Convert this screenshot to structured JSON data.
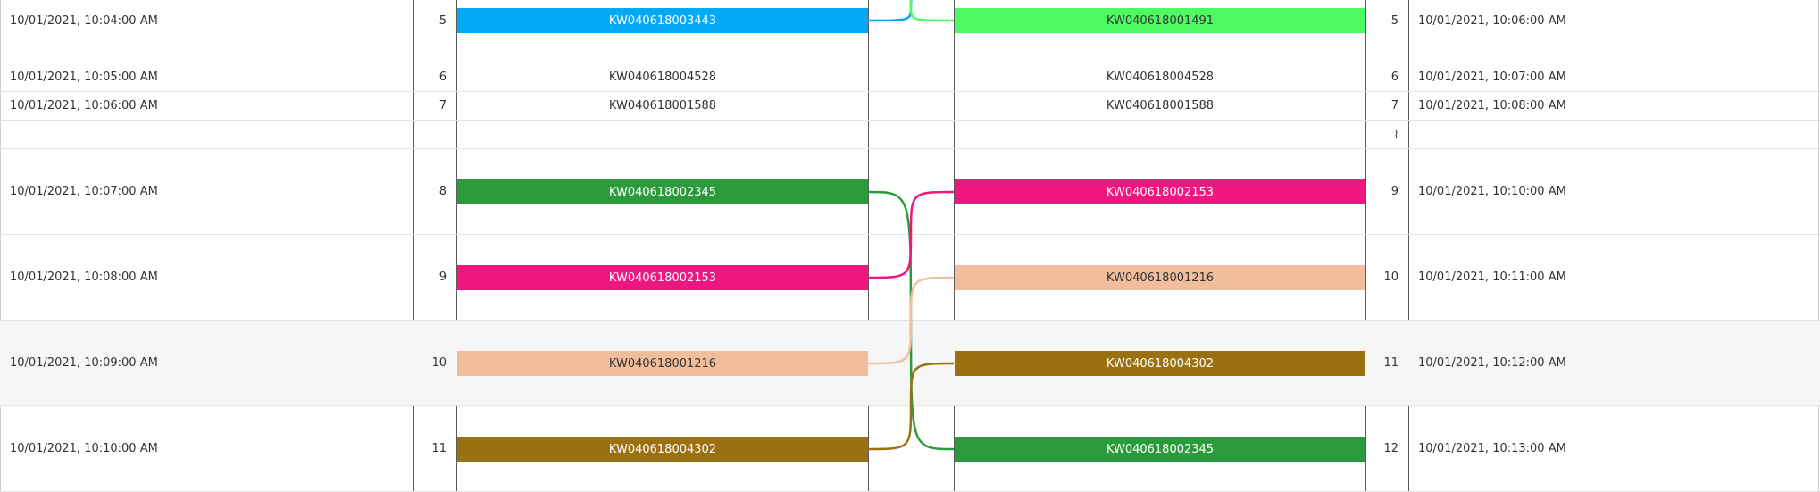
{
  "left_rows": [
    {
      "time": "10/01/2021, 10:04:00 AM",
      "index": "5",
      "value": "KW040618003443"
    },
    {
      "time": "10/01/2021, 10:05:00 AM",
      "index": "6",
      "value": "KW040618004528"
    },
    {
      "time": "10/01/2021, 10:06:00 AM",
      "index": "7",
      "value": "KW040618001588"
    },
    {
      "time": "",
      "index": "",
      "value": ""
    },
    {
      "time": "10/01/2021, 10:07:00 AM",
      "index": "8",
      "value": "KW040618002345"
    },
    {
      "time": "10/01/2021, 10:08:00 AM",
      "index": "9",
      "value": "KW040618002153"
    },
    {
      "time": "10/01/2021, 10:09:00 AM",
      "index": "10",
      "value": "KW040618001216"
    },
    {
      "time": "10/01/2021, 10:10:00 AM",
      "index": "11",
      "value": "KW040618004302"
    }
  ],
  "right_rows": [
    {
      "time": "10/01/2021, 10:06:00 AM",
      "index": "5",
      "value": "KW040618001491"
    },
    {
      "time": "10/01/2021, 10:07:00 AM",
      "index": "6",
      "value": "KW040618004528"
    },
    {
      "time": "10/01/2021, 10:08:00 AM",
      "index": "7",
      "value": "KW040618001588"
    },
    {
      "time": "",
      "index": "≀",
      "value": ""
    },
    {
      "time": "10/01/2021, 10:10:00 AM",
      "index": "9",
      "value": "KW040618002153"
    },
    {
      "time": "10/01/2021, 10:11:00 AM",
      "index": "10",
      "value": "KW040618001216"
    },
    {
      "time": "10/01/2021, 10:12:00 AM",
      "index": "11",
      "value": "KW040618004302"
    },
    {
      "time": "10/01/2021, 10:13:00 AM",
      "index": "12",
      "value": "KW040618002345"
    }
  ],
  "highlights": {
    "left": [
      {
        "row": 0,
        "color": "#03a9f4",
        "text_color": "#ffffff"
      },
      {
        "row": 4,
        "color": "#2a9a3a",
        "text_color": "#ffffff"
      },
      {
        "row": 5,
        "color": "#ef1680",
        "text_color": "#ffffff"
      },
      {
        "row": 6,
        "color": "#f2bd9c",
        "text_color": "#333333"
      },
      {
        "row": 7,
        "color": "#9b7012",
        "text_color": "#ffffff"
      }
    ],
    "right": [
      {
        "row": 0,
        "color": "#4dfa62",
        "text_color": "#333333"
      },
      {
        "row": 4,
        "color": "#ef1680",
        "text_color": "#ffffff"
      },
      {
        "row": 5,
        "color": "#f2bd9c",
        "text_color": "#333333"
      },
      {
        "row": 6,
        "color": "#9b7012",
        "text_color": "#ffffff"
      },
      {
        "row": 7,
        "color": "#2a9a3a",
        "text_color": "#ffffff"
      }
    ]
  },
  "links": [
    {
      "from_row": 0,
      "to_row": -1,
      "color": "#03a9f4"
    },
    {
      "from_row": -1,
      "to_row": 0,
      "color": "#4dfa62"
    },
    {
      "from_row": 4,
      "to_row": 7,
      "color": "#2a9a3a"
    },
    {
      "from_row": 5,
      "to_row": 4,
      "color": "#ef1680"
    },
    {
      "from_row": 6,
      "to_row": 5,
      "color": "#f2bd9c"
    },
    {
      "from_row": 7,
      "to_row": 6,
      "color": "#9b7012"
    }
  ]
}
